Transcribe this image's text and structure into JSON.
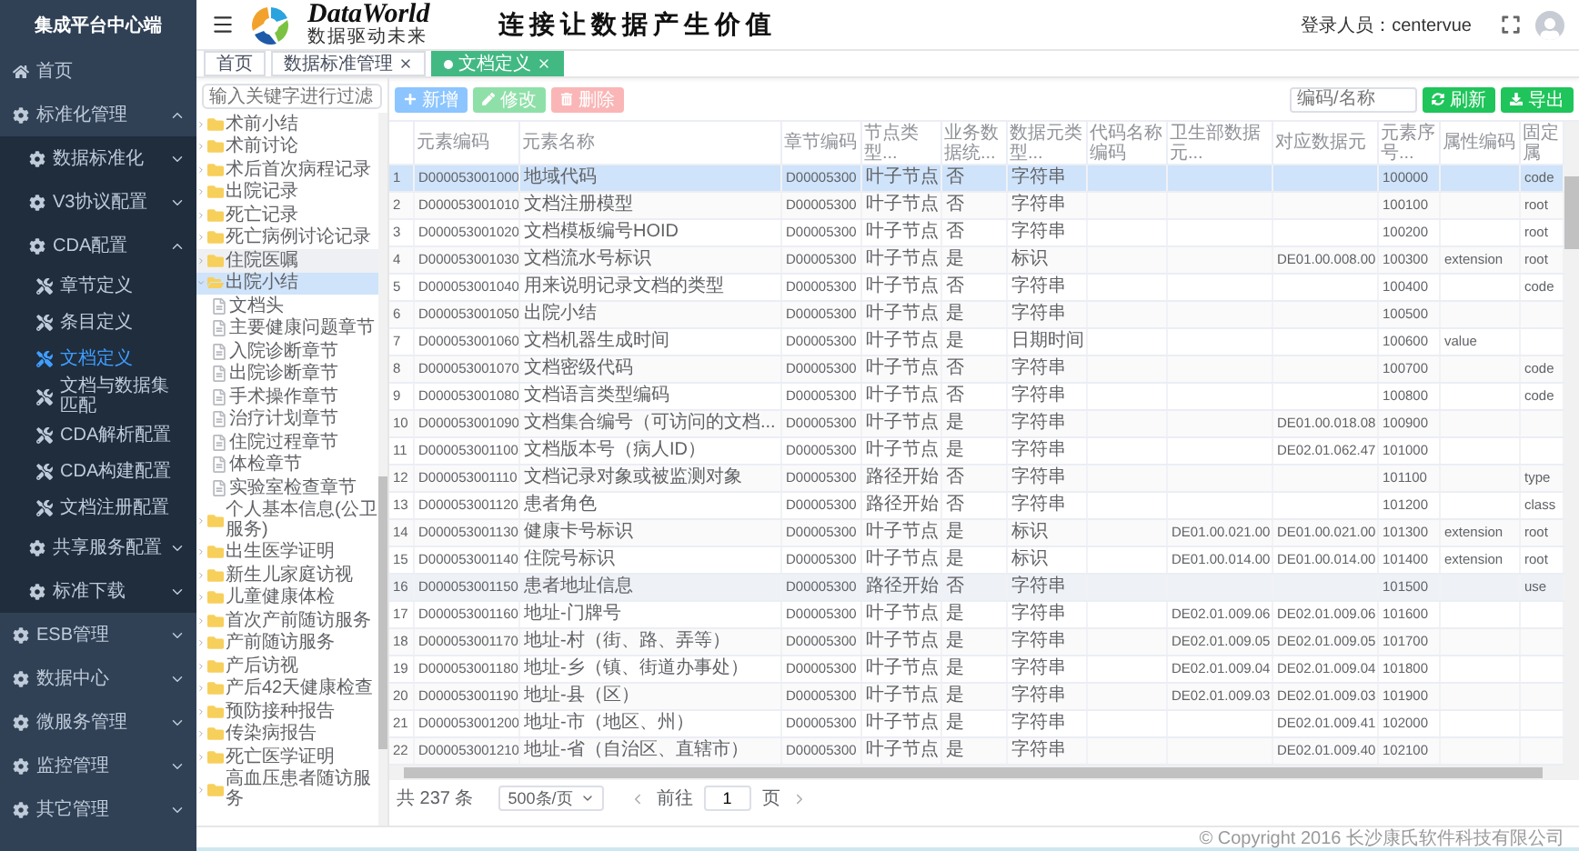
{
  "sidebar": {
    "title": "集成平台中心端",
    "items": [
      {
        "label": "首页",
        "kind": "page"
      },
      {
        "label": "标准化管理",
        "kind": "menu",
        "expanded": true,
        "children": [
          {
            "label": "数据标准化",
            "kind": "menu",
            "expanded": false
          },
          {
            "label": "V3协议配置",
            "kind": "menu",
            "expanded": false
          },
          {
            "label": "CDA配置",
            "kind": "menu",
            "expanded": true,
            "children": [
              {
                "label": "章节定义",
                "kind": "leaf",
                "selected": false
              },
              {
                "label": "条目定义",
                "kind": "leaf",
                "selected": false
              },
              {
                "label": "文档定义",
                "kind": "leaf",
                "selected": true
              },
              {
                "label": "文档与数据集匹配",
                "kind": "leaf",
                "selected": false
              },
              {
                "label": "CDA解析配置",
                "kind": "leaf",
                "selected": false
              },
              {
                "label": "CDA构建配置",
                "kind": "leaf",
                "selected": false
              },
              {
                "label": "文档注册配置",
                "kind": "leaf",
                "selected": false
              }
            ]
          },
          {
            "label": "共享服务配置",
            "kind": "menu",
            "expanded": false
          },
          {
            "label": "标准下载",
            "kind": "menu",
            "expanded": false
          }
        ]
      },
      {
        "label": "ESB管理",
        "kind": "menu",
        "expanded": false
      },
      {
        "label": "数据中心",
        "kind": "menu",
        "expanded": false
      },
      {
        "label": "微服务管理",
        "kind": "menu",
        "expanded": false
      },
      {
        "label": "监控管理",
        "kind": "menu",
        "expanded": false
      },
      {
        "label": "其它管理",
        "kind": "menu",
        "expanded": false
      }
    ]
  },
  "header": {
    "brand": "DataWorld",
    "brand_subtitle": "数据驱动未来",
    "slogan": "连接让数据产生价值",
    "user_label": "登录人员：",
    "user": "centervue"
  },
  "tabs": [
    {
      "label": "首页",
      "selected": false,
      "closable": false
    },
    {
      "label": "数据标准管理",
      "selected": false,
      "closable": true
    },
    {
      "label": "文档定义",
      "selected": true,
      "closable": true
    }
  ],
  "tree": {
    "search": {
      "placeholder": "输入关键字进行过滤"
    },
    "items": [
      {
        "label": "术前小结",
        "kind": "folder",
        "expanded": false,
        "selected": false,
        "hovered": false
      },
      {
        "label": "术前讨论",
        "kind": "folder",
        "expanded": false,
        "selected": false,
        "hovered": false
      },
      {
        "label": "术后首次病程记录",
        "kind": "folder",
        "expanded": false,
        "selected": false,
        "hovered": false
      },
      {
        "label": "出院记录",
        "kind": "folder",
        "expanded": false,
        "selected": false,
        "hovered": false
      },
      {
        "label": "死亡记录",
        "kind": "folder",
        "expanded": false,
        "selected": false,
        "hovered": false
      },
      {
        "label": "死亡病例讨论记录",
        "kind": "folder",
        "expanded": false,
        "selected": false,
        "hovered": false
      },
      {
        "label": "住院医嘱",
        "kind": "folder",
        "expanded": false,
        "selected": false,
        "hovered": true
      },
      {
        "label": "出院小结",
        "kind": "folder",
        "expanded": true,
        "selected": true,
        "hovered": false,
        "children": [
          {
            "label": "文档头",
            "kind": "file",
            "selected": false,
            "hovered": false
          },
          {
            "label": "主要健康问题章节",
            "kind": "file",
            "selected": false,
            "hovered": false
          },
          {
            "label": "入院诊断章节",
            "kind": "file",
            "selected": false,
            "hovered": false
          },
          {
            "label": "出院诊断章节",
            "kind": "file",
            "selected": false,
            "hovered": false
          },
          {
            "label": "手术操作章节",
            "kind": "file",
            "selected": false,
            "hovered": false
          },
          {
            "label": "治疗计划章节",
            "kind": "file",
            "selected": false,
            "hovered": false
          },
          {
            "label": "住院过程章节",
            "kind": "file",
            "selected": false,
            "hovered": false
          },
          {
            "label": "体检章节",
            "kind": "file",
            "selected": false,
            "hovered": false
          },
          {
            "label": "实验室检查章节",
            "kind": "file",
            "selected": false,
            "hovered": false
          }
        ]
      },
      {
        "label": "个人基本信息(公卫服务)",
        "kind": "folder",
        "expanded": false,
        "selected": false,
        "hovered": false
      },
      {
        "label": "出生医学证明",
        "kind": "folder",
        "expanded": false,
        "selected": false,
        "hovered": false
      },
      {
        "label": "新生儿家庭访视",
        "kind": "folder",
        "expanded": false,
        "selected": false,
        "hovered": false
      },
      {
        "label": "儿童健康体检",
        "kind": "folder",
        "expanded": false,
        "selected": false,
        "hovered": false
      },
      {
        "label": "首次产前随访服务",
        "kind": "folder",
        "expanded": false,
        "selected": false,
        "hovered": false
      },
      {
        "label": "产前随访服务",
        "kind": "folder",
        "expanded": false,
        "selected": false,
        "hovered": false
      },
      {
        "label": "产后访视",
        "kind": "folder",
        "expanded": false,
        "selected": false,
        "hovered": false
      },
      {
        "label": "产后42天健康检查",
        "kind": "folder",
        "expanded": false,
        "selected": false,
        "hovered": false
      },
      {
        "label": "预防接种报告",
        "kind": "folder",
        "expanded": false,
        "selected": false,
        "hovered": false
      },
      {
        "label": "传染病报告",
        "kind": "folder",
        "expanded": false,
        "selected": false,
        "hovered": false
      },
      {
        "label": "死亡医学证明",
        "kind": "folder",
        "expanded": false,
        "selected": false,
        "hovered": false
      },
      {
        "label": "高血压患者随访服务",
        "kind": "folder",
        "expanded": false,
        "selected": false,
        "hovered": false
      }
    ]
  },
  "toolbar": {
    "buttons": [
      {
        "label": "新增",
        "kind": "add"
      },
      {
        "label": "修改",
        "kind": "edit"
      },
      {
        "label": "删除",
        "kind": "delete"
      }
    ],
    "search": {
      "placeholder": "编码/名称"
    },
    "actions": [
      {
        "label": "刷新",
        "kind": "refresh"
      },
      {
        "label": "导出",
        "kind": "export"
      }
    ]
  },
  "table": {
    "columns": [
      "元素编码",
      "元素名称",
      "章节编码",
      "节点类型...",
      "业务数据统...",
      "数据元类型...",
      "代码名称编码",
      "卫生部数据元...",
      "对应数据元",
      "元素序号...",
      "属性编码",
      "固定属"
    ],
    "rows": [
      {
        "index": "1",
        "selected": true,
        "hovered": false,
        "cells": [
          "D000053001000",
          "地域代码",
          "D00005300",
          "叶子节点",
          "否",
          "字符串",
          null,
          null,
          null,
          "100000",
          null,
          "code"
        ]
      },
      {
        "index": "2",
        "selected": false,
        "hovered": false,
        "cells": [
          "D000053001010",
          "文档注册模型",
          "D00005300",
          "叶子节点",
          "否",
          "字符串",
          null,
          null,
          null,
          "100100",
          null,
          "root"
        ]
      },
      {
        "index": "3",
        "selected": false,
        "hovered": false,
        "cells": [
          "D000053001020",
          "文档模板编号HOID",
          "D00005300",
          "叶子节点",
          "否",
          "字符串",
          null,
          null,
          null,
          "100200",
          null,
          "root"
        ]
      },
      {
        "index": "4",
        "selected": false,
        "hovered": false,
        "cells": [
          "D000053001030",
          "文档流水号标识",
          "D00005300",
          "叶子节点",
          "是",
          "标识",
          null,
          null,
          "DE01.00.008.00",
          "100300",
          "extension",
          "root"
        ]
      },
      {
        "index": "5",
        "selected": false,
        "hovered": false,
        "cells": [
          "D000053001040",
          "用来说明记录文档的类型",
          "D00005300",
          "叶子节点",
          "否",
          "字符串",
          null,
          null,
          null,
          "100400",
          null,
          "code"
        ]
      },
      {
        "index": "6",
        "selected": false,
        "hovered": false,
        "cells": [
          "D000053001050",
          "出院小结",
          "D00005300",
          "叶子节点",
          "是",
          "字符串",
          null,
          null,
          null,
          "100500",
          null,
          null
        ]
      },
      {
        "index": "7",
        "selected": false,
        "hovered": false,
        "cells": [
          "D000053001060",
          "文档机器生成时间",
          "D00005300",
          "叶子节点",
          "是",
          "日期时间",
          null,
          null,
          null,
          "100600",
          "value",
          null
        ]
      },
      {
        "index": "8",
        "selected": false,
        "hovered": false,
        "cells": [
          "D000053001070",
          "文档密级代码",
          "D00005300",
          "叶子节点",
          "否",
          "字符串",
          null,
          null,
          null,
          "100700",
          null,
          "code"
        ]
      },
      {
        "index": "9",
        "selected": false,
        "hovered": false,
        "cells": [
          "D000053001080",
          "文档语言类型编码",
          "D00005300",
          "叶子节点",
          "否",
          "字符串",
          null,
          null,
          null,
          "100800",
          null,
          "code"
        ]
      },
      {
        "index": "10",
        "selected": false,
        "hovered": false,
        "cells": [
          "D000053001090",
          "文档集合编号（可访问的文档...",
          "D00005300",
          "叶子节点",
          "是",
          "字符串",
          null,
          null,
          "DE01.00.018.08",
          "100900",
          null,
          null
        ]
      },
      {
        "index": "11",
        "selected": false,
        "hovered": false,
        "cells": [
          "D000053001100",
          "文档版本号（病人ID）",
          "D00005300",
          "叶子节点",
          "是",
          "字符串",
          null,
          null,
          "DE02.01.062.47",
          "101000",
          null,
          null
        ]
      },
      {
        "index": "12",
        "selected": false,
        "hovered": false,
        "cells": [
          "D000053001110",
          "文档记录对象或被监测对象",
          "D00005300",
          "路径开始",
          "否",
          "字符串",
          null,
          null,
          null,
          "101100",
          null,
          "type"
        ]
      },
      {
        "index": "13",
        "selected": false,
        "hovered": false,
        "cells": [
          "D000053001120",
          "患者角色",
          "D00005300",
          "路径开始",
          "否",
          "字符串",
          null,
          null,
          null,
          "101200",
          null,
          "class"
        ]
      },
      {
        "index": "14",
        "selected": false,
        "hovered": false,
        "cells": [
          "D000053001130",
          "健康卡号标识",
          "D00005300",
          "叶子节点",
          "是",
          "标识",
          null,
          "DE01.00.021.00",
          "DE01.00.021.00",
          "101300",
          "extension",
          "root"
        ]
      },
      {
        "index": "15",
        "selected": false,
        "hovered": false,
        "cells": [
          "D000053001140",
          "住院号标识",
          "D00005300",
          "叶子节点",
          "是",
          "标识",
          null,
          "DE01.00.014.00",
          "DE01.00.014.00",
          "101400",
          "extension",
          "root"
        ]
      },
      {
        "index": "16",
        "selected": false,
        "hovered": true,
        "cells": [
          "D000053001150",
          "患者地址信息",
          "D00005300",
          "路径开始",
          "否",
          "字符串",
          null,
          null,
          null,
          "101500",
          null,
          "use"
        ]
      },
      {
        "index": "17",
        "selected": false,
        "hovered": false,
        "cells": [
          "D000053001160",
          "地址-门牌号",
          "D00005300",
          "叶子节点",
          "是",
          "字符串",
          null,
          "DE02.01.009.06",
          "DE02.01.009.06",
          "101600",
          null,
          null
        ]
      },
      {
        "index": "18",
        "selected": false,
        "hovered": false,
        "cells": [
          "D000053001170",
          "地址-村（街、路、弄等）",
          "D00005300",
          "叶子节点",
          "是",
          "字符串",
          null,
          "DE02.01.009.05",
          "DE02.01.009.05",
          "101700",
          null,
          null
        ]
      },
      {
        "index": "19",
        "selected": false,
        "hovered": false,
        "cells": [
          "D000053001180",
          "地址-乡（镇、街道办事处）",
          "D00005300",
          "叶子节点",
          "是",
          "字符串",
          null,
          "DE02.01.009.04",
          "DE02.01.009.04",
          "101800",
          null,
          null
        ]
      },
      {
        "index": "20",
        "selected": false,
        "hovered": false,
        "cells": [
          "D000053001190",
          "地址-县（区）",
          "D00005300",
          "叶子节点",
          "是",
          "字符串",
          null,
          "DE02.01.009.03",
          "DE02.01.009.03",
          "101900",
          null,
          null
        ]
      },
      {
        "index": "21",
        "selected": false,
        "hovered": false,
        "cells": [
          "D000053001200",
          "地址-市（地区、州）",
          "D00005300",
          "叶子节点",
          "是",
          "字符串",
          null,
          null,
          "DE02.01.009.41",
          "102000",
          null,
          null
        ]
      },
      {
        "index": "22",
        "selected": false,
        "hovered": false,
        "cells": [
          "D000053001210",
          "地址-省（自治区、直辖市）",
          "D00005300",
          "叶子节点",
          "是",
          "字符串",
          null,
          null,
          "DE02.01.009.40",
          "102100",
          null,
          null
        ]
      }
    ]
  },
  "pagination": {
    "total": "共 237 条",
    "page_size": "500条/页",
    "goto_label": "前往",
    "page": "1",
    "page_suffix": "页"
  },
  "footer": {
    "copyright": "© Copyright 2016 长沙康氏软件科技有限公司"
  }
}
